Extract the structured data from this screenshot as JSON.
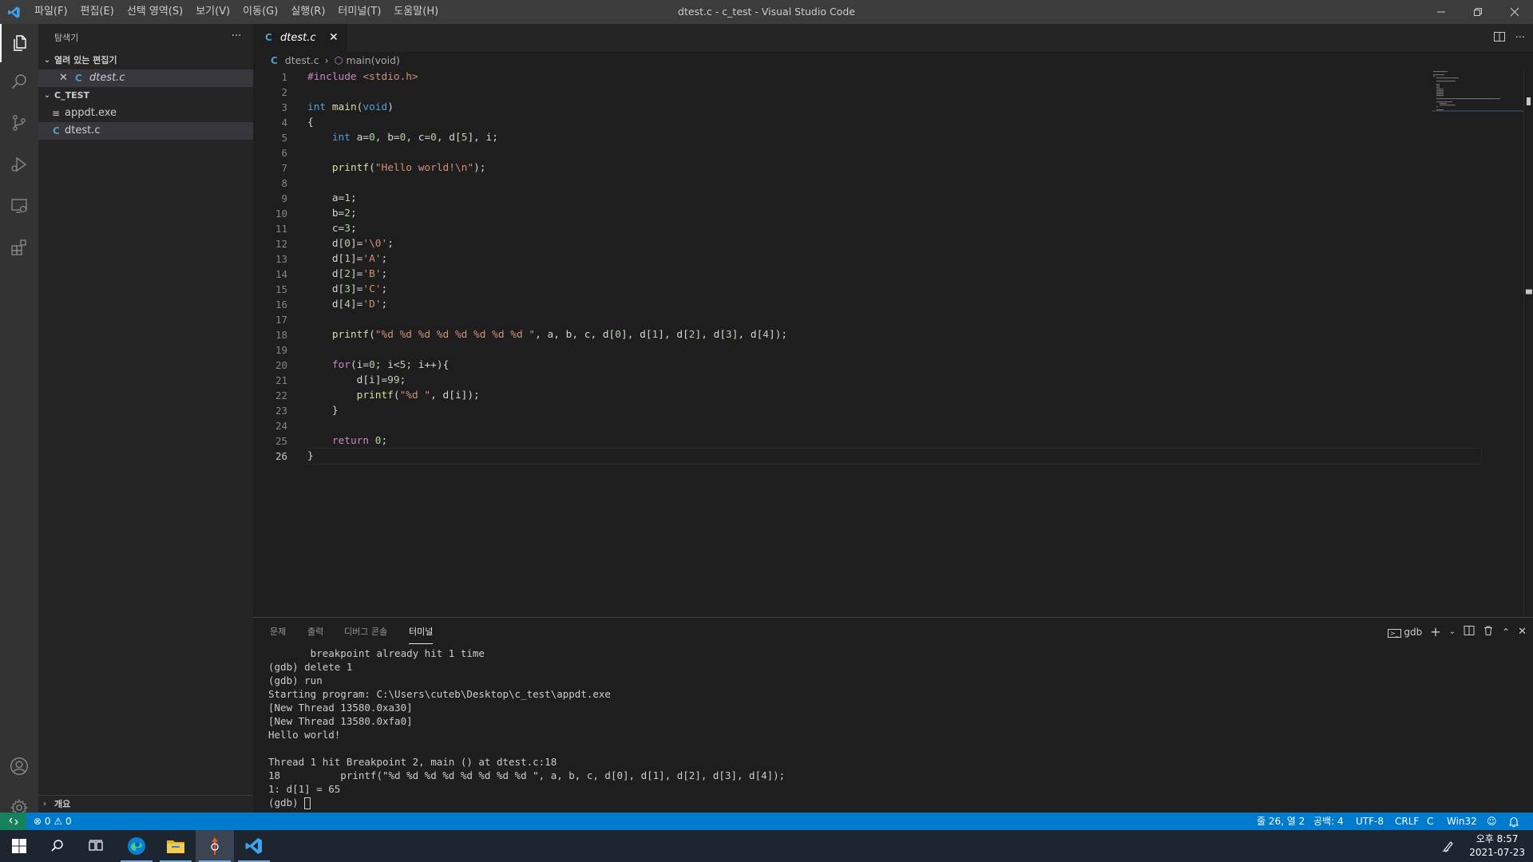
{
  "window": {
    "title": "dtest.c - c_test - Visual Studio Code",
    "menu": [
      "파일(F)",
      "편집(E)",
      "선택 영역(S)",
      "보기(V)",
      "이동(G)",
      "실행(R)",
      "터미널(T)",
      "도움말(H)"
    ]
  },
  "sidebar": {
    "title": "탐색기",
    "more": "···",
    "open_editors_header": "열려 있는 편집기",
    "open_editors": [
      {
        "name": "dtest.c"
      }
    ],
    "folder_header": "C_TEST",
    "files": [
      {
        "name": "appdt.exe"
      },
      {
        "name": "dtest.c"
      }
    ],
    "outline_header": "개요"
  },
  "editor": {
    "tab_label": "dtest.c",
    "breadcrumb_file": "dtest.c",
    "breadcrumb_symbol": "main(void)",
    "line_numbers": [
      "1",
      "2",
      "3",
      "4",
      "5",
      "6",
      "7",
      "8",
      "9",
      "10",
      "11",
      "12",
      "13",
      "14",
      "15",
      "16",
      "17",
      "18",
      "19",
      "20",
      "21",
      "22",
      "23",
      "24",
      "25",
      "26"
    ],
    "lines": [
      "#include <stdio.h>",
      "",
      "int main(void)",
      "{",
      "    int a=0, b=0, c=0, d[5], i;",
      "",
      "    printf(\"Hello world!\\n\");",
      "",
      "    a=1;",
      "    b=2;",
      "    c=3;",
      "    d[0]='\\0';",
      "    d[1]='A';",
      "    d[2]='B';",
      "    d[3]='C';",
      "    d[4]='D';",
      "",
      "    printf(\"%d %d %d %d %d %d %d %d \", a, b, c, d[0], d[1], d[2], d[3], d[4]);",
      "",
      "    for(i=0; i<5; i++){",
      "        d[i]=99;",
      "        printf(\"%d \", d[i]);",
      "    }",
      "",
      "    return 0;",
      "}"
    ]
  },
  "panel": {
    "tabs": [
      "문제",
      "출력",
      "디버그 콘솔",
      "터미널"
    ],
    "active_tab": "터미널",
    "terminal_name": "gdb",
    "terminal_lines": [
      "       breakpoint already hit 1 time",
      "(gdb) delete 1",
      "(gdb) run",
      "Starting program: C:\\Users\\cuteb\\Desktop\\c_test\\appdt.exe",
      "[New Thread 13580.0xa30]",
      "[New Thread 13580.0xfa0]",
      "Hello world!",
      "",
      "Thread 1 hit Breakpoint 2, main () at dtest.c:18",
      "18          printf(\"%d %d %d %d %d %d %d %d \", a, b, c, d[0], d[1], d[2], d[3], d[4]);",
      "1: d[1] = 65"
    ],
    "prompt": "(gdb) "
  },
  "statusbar": {
    "errors": "0",
    "warnings": "0",
    "position": "줄 26, 열 2",
    "spaces": "공백: 4",
    "encoding": "UTF-8",
    "eol": "CRLF",
    "language": "C",
    "platform": "Win32"
  },
  "taskbar": {
    "time": "오후 8:57",
    "date": "2021-07-23"
  },
  "colors": {
    "statusbar": "#007acc",
    "activitybar": "#333333",
    "sidebar": "#252526",
    "editor": "#1e1e1e",
    "titlebar": "#3c3c3c"
  }
}
